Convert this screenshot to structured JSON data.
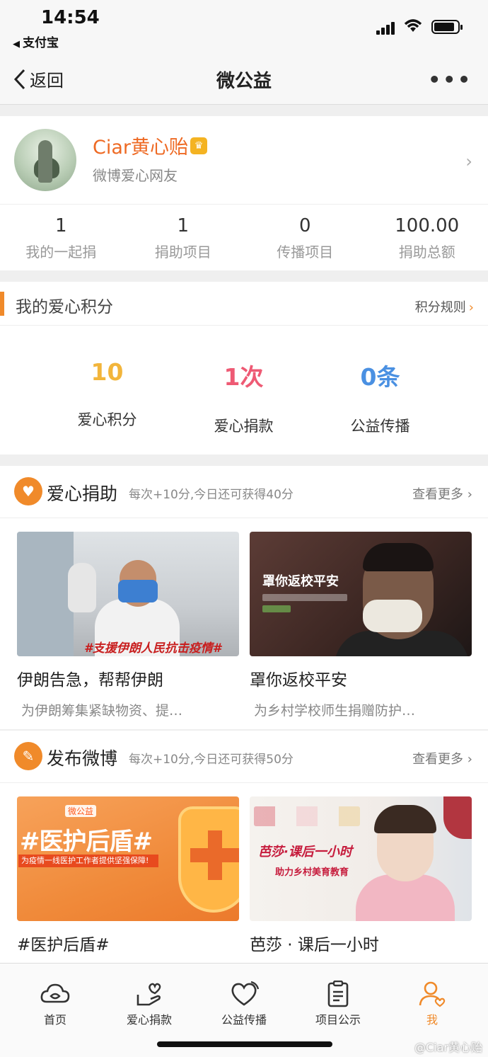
{
  "status_bar": {
    "time": "14:54",
    "back_app": "支付宝"
  },
  "nav": {
    "back_label": "返回",
    "title": "微公益",
    "more": "•••"
  },
  "profile": {
    "name": "Ciar黄心贻",
    "subtitle": "微博爱心网友",
    "stats": [
      {
        "value": "1",
        "label": "我的一起捐"
      },
      {
        "value": "1",
        "label": "捐助项目"
      },
      {
        "value": "0",
        "label": "传播项目"
      },
      {
        "value": "100.00",
        "label": "捐助总额"
      }
    ]
  },
  "points": {
    "title": "我的爱心积分",
    "rule_link": "积分规则",
    "items": [
      {
        "value": "10",
        "label": "爱心积分",
        "color": "#f2b53b"
      },
      {
        "value": "1次",
        "label": "爱心捐款",
        "color": "#ee5a74"
      },
      {
        "value": "0条",
        "label": "公益传播",
        "color": "#4a90e2"
      }
    ]
  },
  "donate_section": {
    "title": "爱心捐助",
    "desc": "每次+10分,今日还可获得40分",
    "more": "查看更多",
    "cards": [
      {
        "title": "伊朗告急，帮帮伊朗",
        "desc": "为伊朗筹集紧缺物资、提…",
        "image_caption": "#支援伊朗人民抗击疫情#"
      },
      {
        "title": "罩你返校平安",
        "desc": "为乡村学校师生捐赠防护…",
        "image_caption": "罩你返校平安"
      }
    ]
  },
  "weibo_section": {
    "title": "发布微博",
    "desc": "每次+10分,今日还可获得50分",
    "more": "查看更多",
    "cards": [
      {
        "title": "#医护后盾#",
        "image_caption": "#医护后盾#",
        "image_sub": "为疫情一线医护工作者提供坚强保障!",
        "image_tag": "微公益"
      },
      {
        "title": "芭莎 · 课后一小时",
        "image_caption": "芭莎·课后一小时",
        "image_sub": "助力乡村美育教育"
      }
    ]
  },
  "tabbar": [
    {
      "label": "首页",
      "icon": "home-cloud-icon"
    },
    {
      "label": "爱心捐款",
      "icon": "hand-heart-icon"
    },
    {
      "label": "公益传播",
      "icon": "heart-broadcast-icon"
    },
    {
      "label": "项目公示",
      "icon": "clipboard-icon"
    },
    {
      "label": "我",
      "icon": "user-heart-icon",
      "active": true
    }
  ],
  "watermark": "@Ciar黄心贻",
  "colors": {
    "accent": "#f08a2a",
    "name": "#ee6a24"
  }
}
